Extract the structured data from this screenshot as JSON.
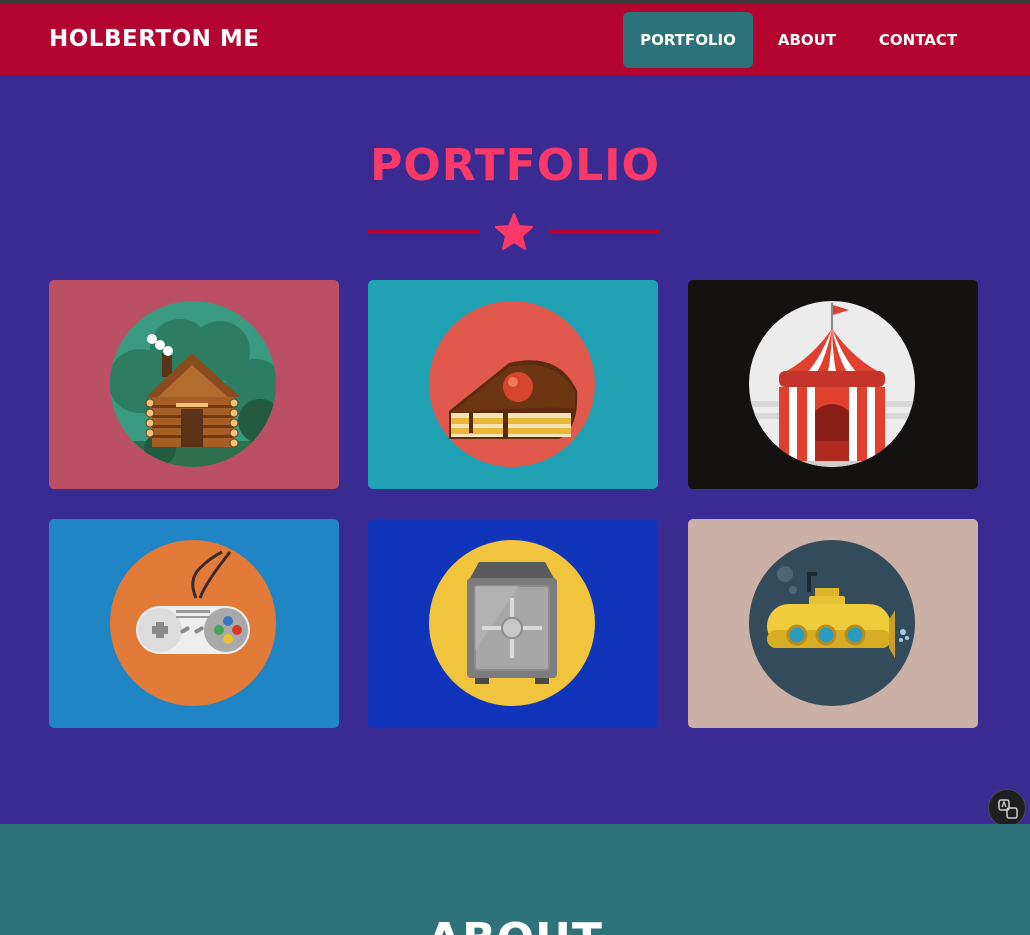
{
  "navbar": {
    "brand": "HOLBERTON ME",
    "items": [
      {
        "label": "PORTFOLIO"
      },
      {
        "label": "ABOUT"
      },
      {
        "label": "CONTACT"
      }
    ]
  },
  "portfolio": {
    "title": "PORTFOLIO",
    "items": [
      {
        "icon": "cabin-icon",
        "bg": "#bb5065"
      },
      {
        "icon": "cake-icon",
        "bg": "#20a2b4"
      },
      {
        "icon": "circus-tent-icon",
        "bg": "#141111"
      },
      {
        "icon": "game-controller-icon",
        "bg": "#1f85c5"
      },
      {
        "icon": "safe-icon",
        "bg": "#1035bb"
      },
      {
        "icon": "submarine-icon",
        "bg": "#cab0a5"
      }
    ]
  },
  "about": {
    "title": "ABOUT"
  },
  "colors": {
    "navbar": "#b30530",
    "accent": "#fb3968",
    "active_nav": "#2e737a",
    "page_bg": "#3a2b93",
    "about_bg": "#2e737a"
  }
}
